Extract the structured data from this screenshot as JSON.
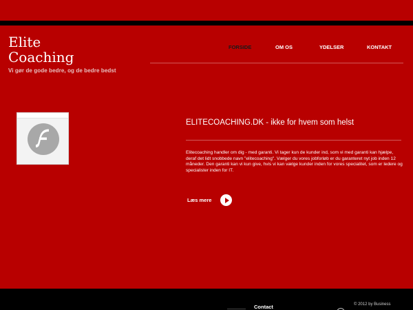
{
  "logo": {
    "title_line1": "Elite",
    "title_line2": "Coaching",
    "tagline": "Vi gør de gode bedre, og de bedre bedst"
  },
  "nav": {
    "items": [
      {
        "label": "FORSIDE",
        "active": true
      },
      {
        "label": "OM OS",
        "active": false
      },
      {
        "label": "YDELSER",
        "active": false
      },
      {
        "label": "KONTAKT",
        "active": false
      }
    ]
  },
  "main": {
    "flash_placeholder_icon": "flash-player-icon",
    "headline": "ELITECOACHING.DK - ikke for hvem som helst",
    "body": "Elitecoaching handler om dig - med garanti. Vi tager kun de kunder ind, som vi med garanti kan hjælpe, deraf det lidt snobbede navn \"elitecoaching\". Vælger du vores jobforløb er du garanteret nyt job inden 12 måneder. Den garanti kan vi kun give, hvis vi kan vælge kunder inden for vores specialitet, som er ledere og specialister inden for IT.",
    "read_more": "Læs mere",
    "read_more_icon": "play-circle-icon"
  },
  "footer": {
    "contact": "Contact",
    "copyright": "© 2012 by Business"
  },
  "colors": {
    "background": "#b80000",
    "bar": "#000000",
    "text": "#ffffff",
    "active_nav": "#1a1a1a"
  }
}
